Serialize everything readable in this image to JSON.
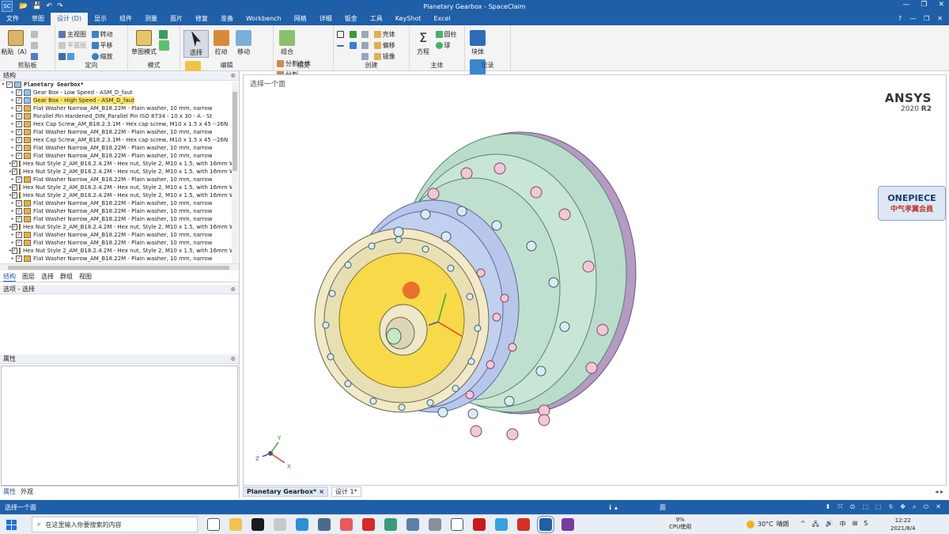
{
  "titlebar": {
    "title": "Planetary Gearbox - SpaceClaim",
    "app_icon": "SC",
    "quick_access": [
      "📂",
      "💾",
      "↶",
      "↷"
    ],
    "window_controls": [
      "—",
      "❐",
      "✕"
    ]
  },
  "menu": {
    "tabs": [
      "文件",
      "草图",
      "设计 (D)",
      "显示",
      "组件",
      "测量",
      "面片",
      "修复",
      "准备",
      "Workbench",
      "网格",
      "详细",
      "钣金",
      "工具",
      "KeyShot",
      "Excel"
    ],
    "active_index": 2,
    "right_controls": [
      "?",
      "—",
      "❐",
      "✕"
    ]
  },
  "ribbon": {
    "clipboard": {
      "paste": "粘贴（A）",
      "label": "剪贴板"
    },
    "orient": {
      "home_view": "主视图",
      "plane_view": "平面图",
      "rotate": "转动",
      "pan": "平移",
      "zoom": "缩放",
      "label": "定向"
    },
    "mode": {
      "sketch_mode": "草图模式",
      "label": "模式"
    },
    "edit": {
      "select": "选择",
      "pull": "拉动",
      "move": "移动",
      "fill": "填充",
      "label": "编辑"
    },
    "intersect": {
      "combine": "组合",
      "split_body": "分割主体",
      "split": "分割",
      "project": "投影",
      "label": "相交"
    },
    "create": {
      "shell": "壳体",
      "offset": "偏移",
      "mirror": "镜像",
      "label": "创建"
    },
    "body": {
      "equation": "方程",
      "cylinder": "圆柱",
      "sphere": "球",
      "label": "主体"
    },
    "record": {
      "block": "块体",
      "script": "脚本",
      "label": "记录"
    }
  },
  "structure": {
    "header": "结构",
    "root": "Planetary Gearbox*",
    "items": [
      {
        "label": "Gear Box - Low Speed - ASM_D_faut",
        "kind": "asm",
        "highlight": false
      },
      {
        "label": "Gear Box - High Speed - ASM_D_faut",
        "kind": "asm",
        "highlight": true
      },
      {
        "label": "Flat Washer Narrow_AM_B18.22M - Plain washer, 10 mm, narrow",
        "kind": "part",
        "highlight": false
      },
      {
        "label": "Parallel Pin Hardened_DIN_Parallel Pin ISO 8734 - 10 x 30 - A - St",
        "kind": "part",
        "highlight": false
      },
      {
        "label": "Hex Cap Screw_AM_B18.2.3.1M - Hex cap screw, M10 x 1.5 x 45 --26N",
        "kind": "part",
        "highlight": false
      },
      {
        "label": "Flat Washer Narrow_AM_B18.22M - Plain washer, 10 mm, narrow",
        "kind": "part",
        "highlight": false
      },
      {
        "label": "Hex Cap Screw_AM_B18.2.3.1M - Hex cap screw, M10 x 1.5 x 45 --26N",
        "kind": "part",
        "highlight": false
      },
      {
        "label": "Flat Washer Narrow_AM_B18.22M - Plain washer, 10 mm, narrow",
        "kind": "part",
        "highlight": false
      },
      {
        "label": "Flat Washer Narrow_AM_B18.22M - Plain washer, 10 mm, narrow",
        "kind": "part",
        "highlight": false
      },
      {
        "label": "Hex Nut Style 2_AM_B18.2.4.2M - Hex nut, Style 2,  M10 x 1.5, with 16mm WA",
        "kind": "part",
        "highlight": false
      },
      {
        "label": "Hex Nut Style 2_AM_B18.2.4.2M - Hex nut, Style 2,  M10 x 1.5, with 16mm WA",
        "kind": "part",
        "highlight": false
      },
      {
        "label": "Flat Washer Narrow_AM_B18.22M - Plain washer, 10 mm, narrow",
        "kind": "part",
        "highlight": false
      },
      {
        "label": "Hex Nut Style 2_AM_B18.2.4.2M - Hex nut, Style 2,  M10 x 1.5, with 16mm WA",
        "kind": "part",
        "highlight": false
      },
      {
        "label": "Hex Nut Style 2_AM_B18.2.4.2M - Hex nut, Style 2,  M10 x 1.5, with 16mm WA",
        "kind": "part",
        "highlight": false
      },
      {
        "label": "Flat Washer Narrow_AM_B18.22M - Plain washer, 10 mm, narrow",
        "kind": "part",
        "highlight": false
      },
      {
        "label": "Flat Washer Narrow_AM_B18.22M - Plain washer, 10 mm, narrow",
        "kind": "part",
        "highlight": false
      },
      {
        "label": "Flat Washer Narrow_AM_B18.22M - Plain washer, 10 mm, narrow",
        "kind": "part",
        "highlight": false
      },
      {
        "label": "Hex Nut Style 2_AM_B18.2.4.2M - Hex nut, Style 2,  M10 x 1.5, with 16mm WA",
        "kind": "part",
        "highlight": false
      },
      {
        "label": "Flat Washer Narrow_AM_B18.22M - Plain washer, 10 mm, narrow",
        "kind": "part",
        "highlight": false
      },
      {
        "label": "Flat Washer Narrow_AM_B18.22M - Plain washer, 10 mm, narrow",
        "kind": "part",
        "highlight": false
      },
      {
        "label": "Hex Nut Style 2_AM_B18.2.4.2M - Hex nut, Style 2,  M10 x 1.5, with 16mm WA",
        "kind": "part",
        "highlight": false
      },
      {
        "label": "Flat Washer Narrow_AM_B18.22M - Plain washer, 10 mm, narrow",
        "kind": "part",
        "highlight": false
      }
    ]
  },
  "panel_tabs": [
    "结构",
    "图层",
    "选择",
    "群组",
    "视图"
  ],
  "options_header": "选项 - 选择",
  "properties_header": "属性",
  "bottom_tabs": [
    "属性",
    "外观"
  ],
  "viewport": {
    "hint": "选择一个面",
    "logo_brand": "ANSYS",
    "logo_version": "2020",
    "logo_release": "R2",
    "sticker_line1": "ONEPIECE",
    "sticker_line2": "中气孝翼会員",
    "triad": {
      "x": "X",
      "y": "Y",
      "z": "Z"
    }
  },
  "doc_tabs": [
    {
      "label": "Planetary Gearbox*",
      "active": true,
      "close": "×"
    },
    {
      "label": "设计 1*",
      "active": false,
      "close": ""
    }
  ],
  "doc_tab_arrows": "◂ ▸",
  "status": {
    "message": "选择一个面",
    "info_icon": "ℹ",
    "mid_label": "面",
    "tools": [
      "⬍",
      "⤧",
      "⊙",
      "⬚",
      "⬚",
      "⥮",
      "✥",
      "⌕",
      "⬭",
      "✕"
    ]
  },
  "taskbar": {
    "search_placeholder": "在这里输入你要搜索的内容",
    "apps": [
      {
        "name": "task-view",
        "color": "#ffffff"
      },
      {
        "name": "file-explorer",
        "color": "#f2c14e"
      },
      {
        "name": "app-a",
        "color": "#1b1b1b"
      },
      {
        "name": "app-wb",
        "color": "#c9c9c9"
      },
      {
        "name": "edge",
        "color": "#2b8fd8"
      },
      {
        "name": "app-notes",
        "color": "#4a6b8a"
      },
      {
        "name": "app-music",
        "color": "#e85a5a"
      },
      {
        "name": "app-red",
        "color": "#d62828"
      },
      {
        "name": "app-green",
        "color": "#3a9b7a"
      },
      {
        "name": "calculator",
        "color": "#5b7fa6"
      },
      {
        "name": "app-gray",
        "color": "#8a8f96"
      },
      {
        "name": "app-monitor",
        "color": "#ffffff"
      },
      {
        "name": "app-record",
        "color": "#c81d1d"
      },
      {
        "name": "app-cube",
        "color": "#3aa0e0"
      },
      {
        "name": "wps",
        "color": "#d93025"
      },
      {
        "name": "spaceclaim",
        "color": "#1f5fa8"
      },
      {
        "name": "app-m",
        "color": "#7a3b9e"
      }
    ],
    "cpu_percent": "9%",
    "cpu_label": "CPU使用",
    "weather_temp": "30°C",
    "weather_text": "晴朗",
    "tray": [
      "^",
      "🖧",
      "🔊",
      "中",
      "⊞",
      "S"
    ],
    "time": "12:22",
    "date": "2021/8/4"
  }
}
